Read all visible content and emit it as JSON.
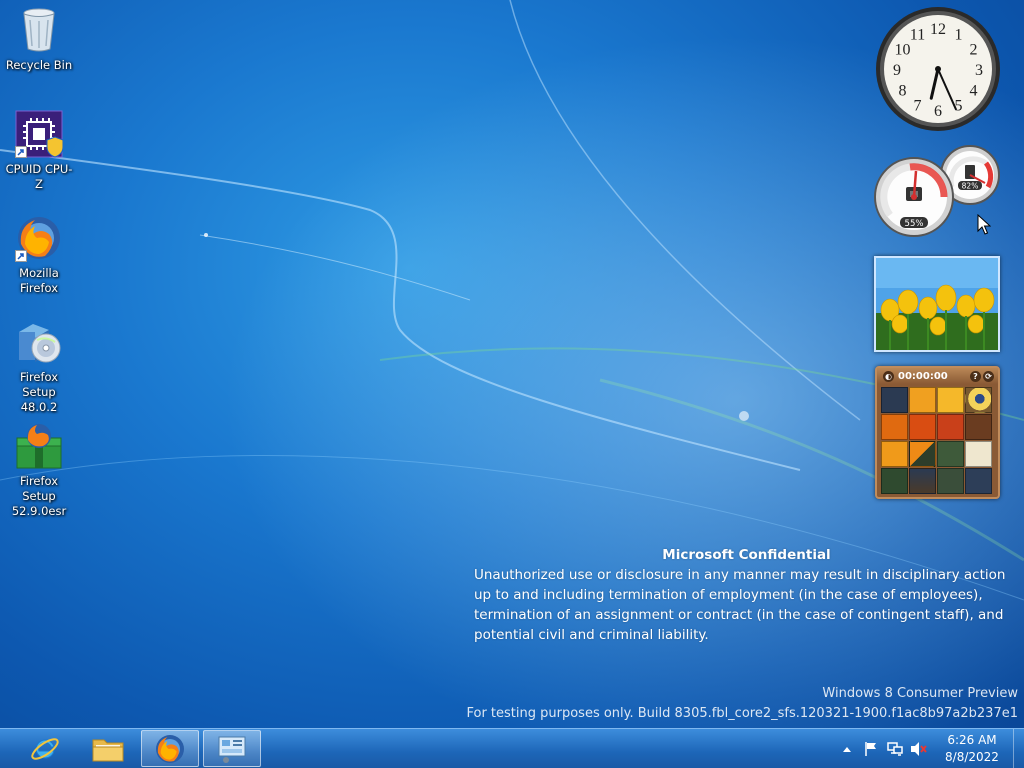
{
  "desktop": {
    "icons": [
      {
        "label": "Recycle Bin",
        "icon": "recycle-bin-icon"
      },
      {
        "label": "CPUID CPU-Z",
        "icon": "cpu-z-icon",
        "shortcut": true
      },
      {
        "label": "Mozilla\nFirefox",
        "icon": "firefox-icon",
        "shortcut": true
      },
      {
        "label": "Firefox Setup\n48.0.2",
        "icon": "installer-icon"
      },
      {
        "label": "Firefox Setup\n52.9.0esr",
        "icon": "firefox-setup-icon"
      }
    ]
  },
  "gadgets": {
    "clock": {
      "numerals": [
        "12",
        "1",
        "2",
        "3",
        "4",
        "5",
        "6",
        "7",
        "8",
        "9",
        "10",
        "11"
      ],
      "hour": 6,
      "minute": 26
    },
    "meter": {
      "cpu_percent": "55%",
      "memory_percent": "82%",
      "cpu_value": 55,
      "memory_value": 82
    },
    "slideshow": {
      "subject": "yellow tulips"
    },
    "puzzle": {
      "timer": "00:00:00",
      "help": "?",
      "shuffle": "⟳"
    }
  },
  "watermark": {
    "title": "Microsoft Confidential",
    "body": "Unauthorized use or disclosure in any manner may result in disciplinary action up to and including termination of employment (in the case of employees), termination of an assignment or contract (in the case of contingent staff), and potential civil and criminal liability.",
    "edition": "Windows 8 Consumer Preview",
    "build": "For testing purposes only. Build 8305.fbl_core2_sfs.120321-1900.f1ac8b97a2b237e1"
  },
  "taskbar": {
    "pinned": [
      {
        "name": "internet-explorer",
        "icon": "ie-icon"
      },
      {
        "name": "file-explorer",
        "icon": "folder-icon"
      },
      {
        "name": "firefox",
        "icon": "firefox-icon",
        "active": true
      },
      {
        "name": "control-panel",
        "icon": "control-panel-icon",
        "active": true
      }
    ],
    "tray": {
      "icons": [
        "show-hidden-icon",
        "action-center-flag-icon",
        "network-icon",
        "volume-muted-icon"
      ],
      "time": "6:26 AM",
      "date": "8/8/2022"
    }
  },
  "colors": {
    "wallpaper_dark": "#0d58b0",
    "wallpaper_light": "#2f9be4",
    "taskbar": "#1d66b8",
    "puzzle_wood": "#8a5a35"
  }
}
